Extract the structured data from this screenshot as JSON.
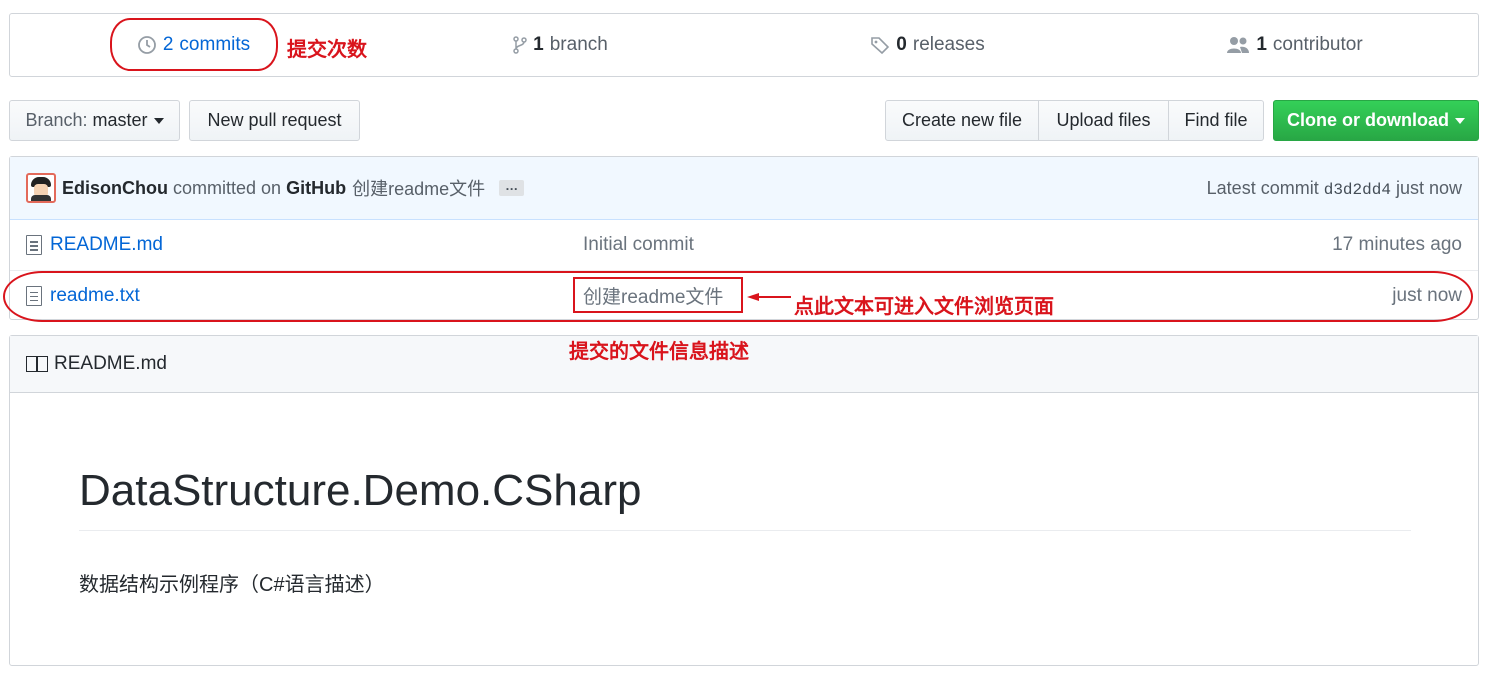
{
  "summary": {
    "commits": {
      "count": "2",
      "label": "commits",
      "icon": "history-icon"
    },
    "branch": {
      "count": "1",
      "label": "branch",
      "icon": "git-branch-icon"
    },
    "releases": {
      "count": "0",
      "label": "releases",
      "icon": "tag-icon"
    },
    "contributors": {
      "count": "1",
      "label": "contributor",
      "icon": "people-icon"
    }
  },
  "toolbar": {
    "branch_prefix": "Branch:",
    "branch_name": "master",
    "new_pr": "New pull request",
    "create_file": "Create new file",
    "upload_files": "Upload files",
    "find_file": "Find file",
    "clone": "Clone or download"
  },
  "commit": {
    "author": "EdisonChou",
    "action": "committed on",
    "platform": "GitHub",
    "message": "创建readme文件",
    "ellipsis": "…",
    "latest_label": "Latest commit",
    "sha": "d3d2dd4",
    "time": "just now"
  },
  "files": [
    {
      "name": "README.md",
      "message": "Initial commit",
      "age": "17 minutes ago"
    },
    {
      "name": "readme.txt",
      "message": "创建readme文件",
      "age": "just now"
    }
  ],
  "readme": {
    "header": "README.md",
    "title": "DataStructure.Demo.CSharp",
    "description": "数据结构示例程序（C#语言描述）"
  },
  "annotations": {
    "commits_note": "提交次数",
    "click_note": "点此文本可进入文件浏览页面",
    "desc_note": "提交的文件信息描述"
  },
  "colors": {
    "link": "#0366d6",
    "green": "#28a745",
    "annotation": "#d9141c"
  }
}
